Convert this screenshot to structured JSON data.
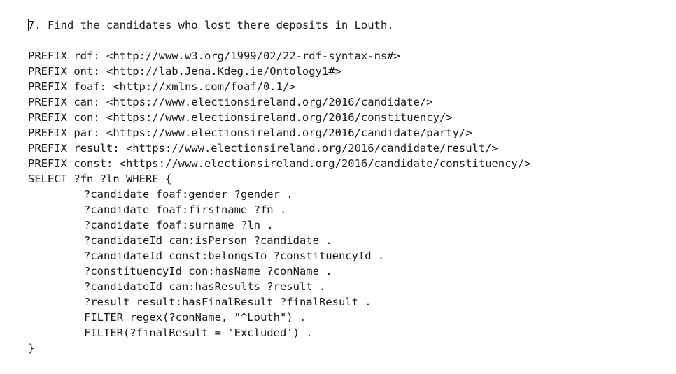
{
  "heading": "7. Find the candidates who lost there deposits in Louth.",
  "prefixes": [
    "PREFIX rdf: <http://www.w3.org/1999/02/22-rdf-syntax-ns#>",
    "PREFIX ont: <http://lab.Jena.Kdeg.ie/Ontology1#>",
    "PREFIX foaf: <http://xmlns.com/foaf/0.1/>",
    "PREFIX can: <https://www.electionsireland.org/2016/candidate/>",
    "PREFIX con: <https://www.electionsireland.org/2016/constituency/>",
    "PREFIX par: <https://www.electionsireland.org/2016/candidate/party/>",
    "PREFIX result: <https://www.electionsireland.org/2016/candidate/result/>",
    "PREFIX const: <https://www.electionsireland.org/2016/candidate/constituency/>"
  ],
  "select_line": "SELECT ?fn ?ln WHERE {",
  "body_lines": [
    "?candidate foaf:gender ?gender .",
    "?candidate foaf:firstname ?fn .",
    "?candidate foaf:surname ?ln .",
    "?candidateId can:isPerson ?candidate .",
    "?candidateId const:belongsTo ?constituencyId .",
    "?constituencyId con:hasName ?conName .",
    "?candidateId can:hasResults ?result .",
    "?result result:hasFinalResult ?finalResult .",
    "FILTER regex(?conName, \"^Louth\") .",
    "FILTER(?finalResult = 'Excluded') ."
  ],
  "closing_line": "}"
}
